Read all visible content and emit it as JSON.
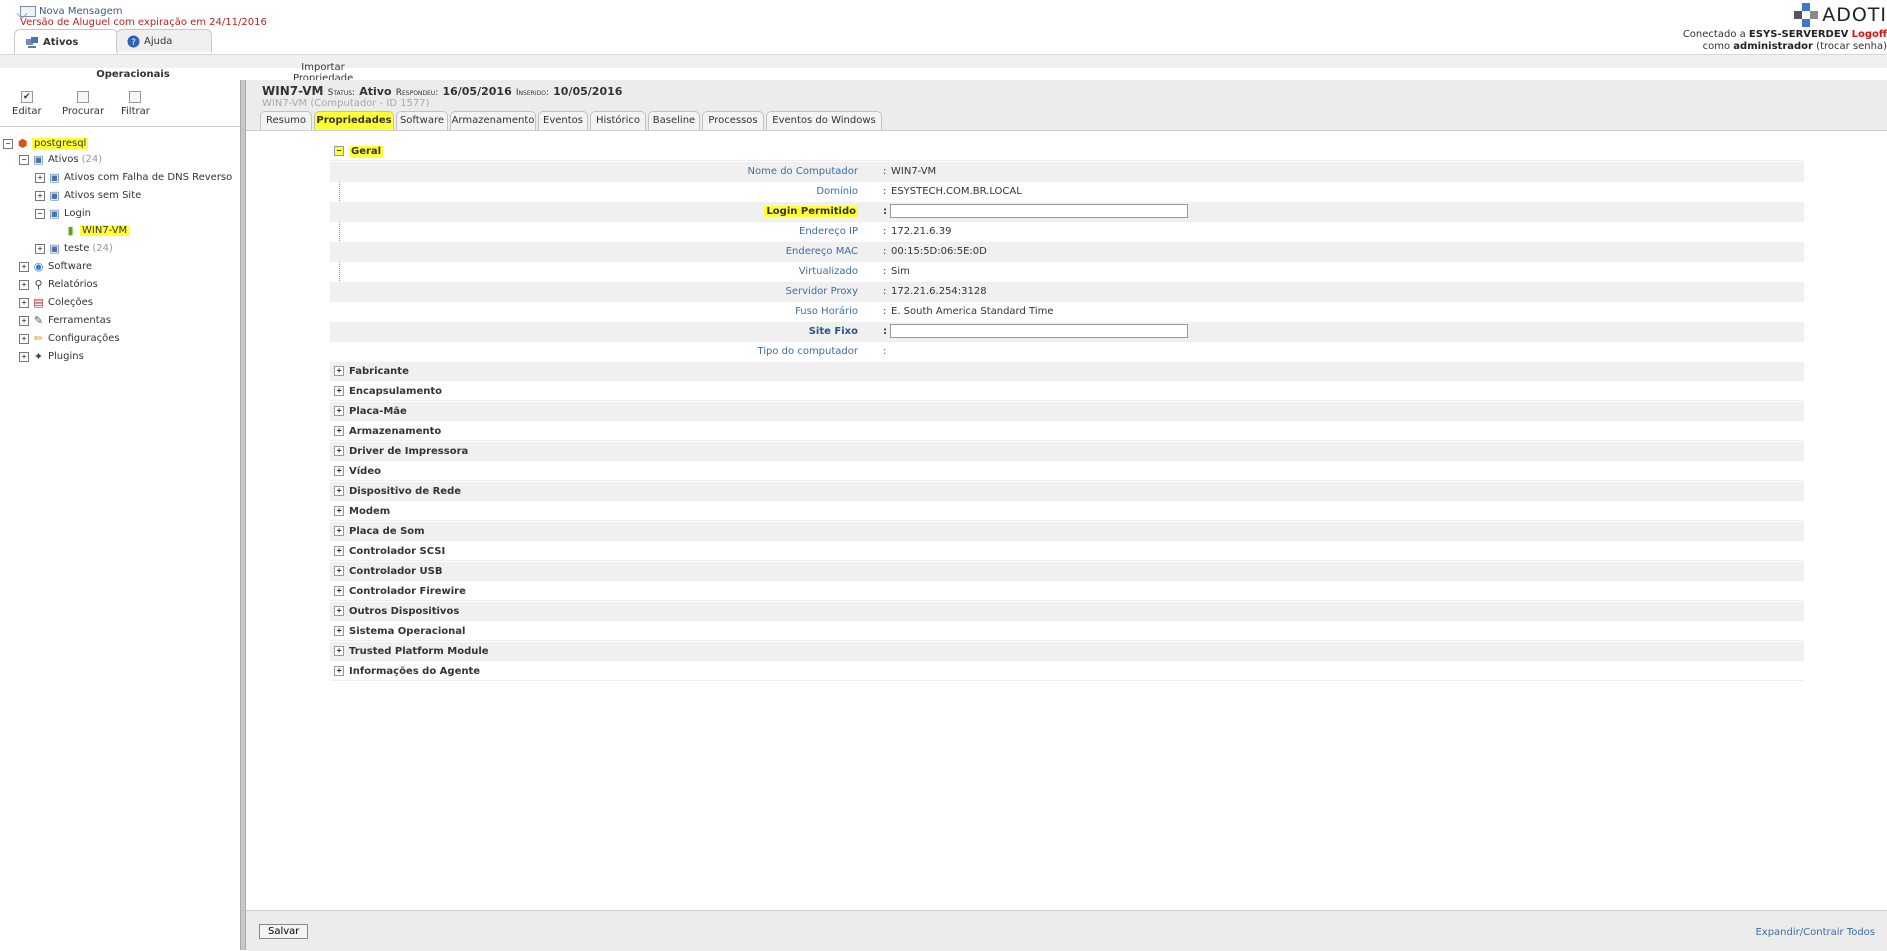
{
  "header": {
    "new_message": "Nova Mensagem",
    "rental_notice": "Versão de Aluguel com expiração em 24/11/2016",
    "tabs": [
      {
        "label": "Ativos"
      },
      {
        "label": "Ajuda"
      }
    ],
    "brand": "ADOTI",
    "connected_prefix": "Conectado a ",
    "server": "ESYS-SERVERDEV",
    "logoff": "Logoff",
    "as_prefix": "como ",
    "user": "administrador",
    "change_password": "(trocar senha)"
  },
  "toolbar": {
    "section_title": "Operacionais",
    "editar": "Editar",
    "procurar": "Procurar",
    "filtrar": "Filtrar",
    "importar": "Importar Propriedades"
  },
  "tree": {
    "root": "postgresql",
    "ativos": "Ativos",
    "ativos_count": "(24)",
    "falha_dns": "Ativos com Falha de DNS Reverso",
    "sem_site": "Ativos sem Site",
    "login": "Login",
    "win7": "WIN7-VM",
    "teste": "teste",
    "teste_count": "(24)",
    "software": "Software",
    "relatorios": "Relatórios",
    "colecoes": "Coleções",
    "ferramentas": "Ferramentas",
    "configuracoes": "Configurações",
    "plugins": "Plugins"
  },
  "asset": {
    "name": "WIN7-VM",
    "status_label": "Status:",
    "status_value": "Ativo",
    "responded_label": "Respondeu:",
    "responded_value": "16/05/2016",
    "inserted_label": "Inserido:",
    "inserted_value": "10/05/2016",
    "subtitle": "WIN7-VM  (Computador - ID 1577)"
  },
  "content_tabs": [
    {
      "label": "Resumo"
    },
    {
      "label": "Propriedades"
    },
    {
      "label": "Software"
    },
    {
      "label": "Armazenamento"
    },
    {
      "label": "Eventos"
    },
    {
      "label": "Histórico"
    },
    {
      "label": "Baseline"
    },
    {
      "label": "Processos"
    },
    {
      "label": "Eventos do Windows"
    }
  ],
  "geral": {
    "title": "Geral",
    "rows": [
      {
        "label": "Nome do Computador",
        "value": "WIN7-VM"
      },
      {
        "label": "Domínio",
        "value": "ESYSTECH.COM.BR.LOCAL"
      },
      {
        "label": "Login Permitido",
        "value": ""
      },
      {
        "label": "Endereço IP",
        "value": "172.21.6.39"
      },
      {
        "label": "Endereço MAC",
        "value": "00:15:5D:06:5E:0D"
      },
      {
        "label": "Virtualizado",
        "value": "Sim"
      },
      {
        "label": "Servidor Proxy",
        "value": "172.21.6.254:3128"
      },
      {
        "label": "Fuso Horário",
        "value": "E. South America Standard Time"
      },
      {
        "label": "Site Fixo",
        "value": ""
      },
      {
        "label": "Tipo do computador",
        "value": ""
      }
    ]
  },
  "sections": [
    "Fabricante",
    "Encapsulamento",
    "Placa-Mãe",
    "Armazenamento",
    "Driver de Impressora",
    "Vídeo",
    "Dispositivo de Rede",
    "Modem",
    "Placa de Som",
    "Controlador SCSI",
    "Controlador USB",
    "Controlador Firewire",
    "Outros Dispositivos",
    "Sistema Operacional",
    "Trusted Platform Module",
    "Informações do Agente"
  ],
  "footer": {
    "save": "Salvar",
    "expand_all": "Expandir/Contrair Todos"
  },
  "colors": {
    "highlight": "#ffff33",
    "label_blue": "#3d6da3",
    "logoff_red": "#dd1111",
    "notice_red": "#bb2222"
  }
}
